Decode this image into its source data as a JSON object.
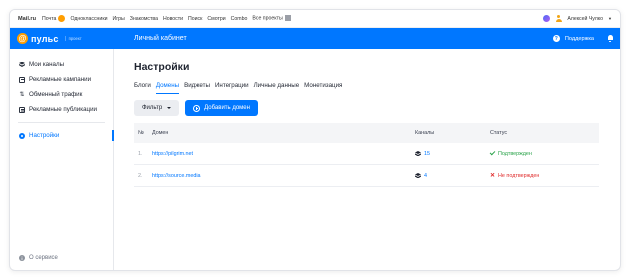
{
  "portal": {
    "brand": "Mail.ru",
    "items": [
      "Почта",
      "Одноклассники",
      "Игры",
      "Знакомства",
      "Новости",
      "Поиск",
      "Смотри",
      "Combo",
      "Все проекты"
    ],
    "user": "Алексей Чулко"
  },
  "header": {
    "logo": "пульс",
    "logo_sub": "проект",
    "title": "Личный кабинет",
    "support": "Поддержка"
  },
  "sidebar": {
    "items": [
      {
        "label": "Мои каналы",
        "icon": "channels-icon"
      },
      {
        "label": "Рекламные кампании",
        "icon": "campaign-icon"
      },
      {
        "label": "Обменный трафик",
        "icon": "exchange-icon"
      },
      {
        "label": "Рекламные публикации",
        "icon": "publication-icon"
      }
    ],
    "settings": "Настройки",
    "about": "О сервисе"
  },
  "main": {
    "title": "Настройки",
    "tabs": [
      "Блоги",
      "Домены",
      "Виджеты",
      "Интеграции",
      "Личные данные",
      "Монетизация"
    ],
    "active_tab": "Домены",
    "filter_label": "Фильтр",
    "add_label": "Добавить домен"
  },
  "table": {
    "headers": [
      "№",
      "Домен",
      "Каналы",
      "Статус"
    ],
    "rows": [
      {
        "num": "1.",
        "domain": "https://pilgrim.net",
        "channels": "15",
        "status": "Подтвержден",
        "ok": true
      },
      {
        "num": "2.",
        "domain": "https://source.media",
        "channels": "4",
        "status": "Не подтвержден",
        "ok": false
      }
    ]
  },
  "colors": {
    "accent": "#0077ff",
    "success": "#2aa34a",
    "error": "#e02d2d",
    "logo": "#ff9e00"
  }
}
